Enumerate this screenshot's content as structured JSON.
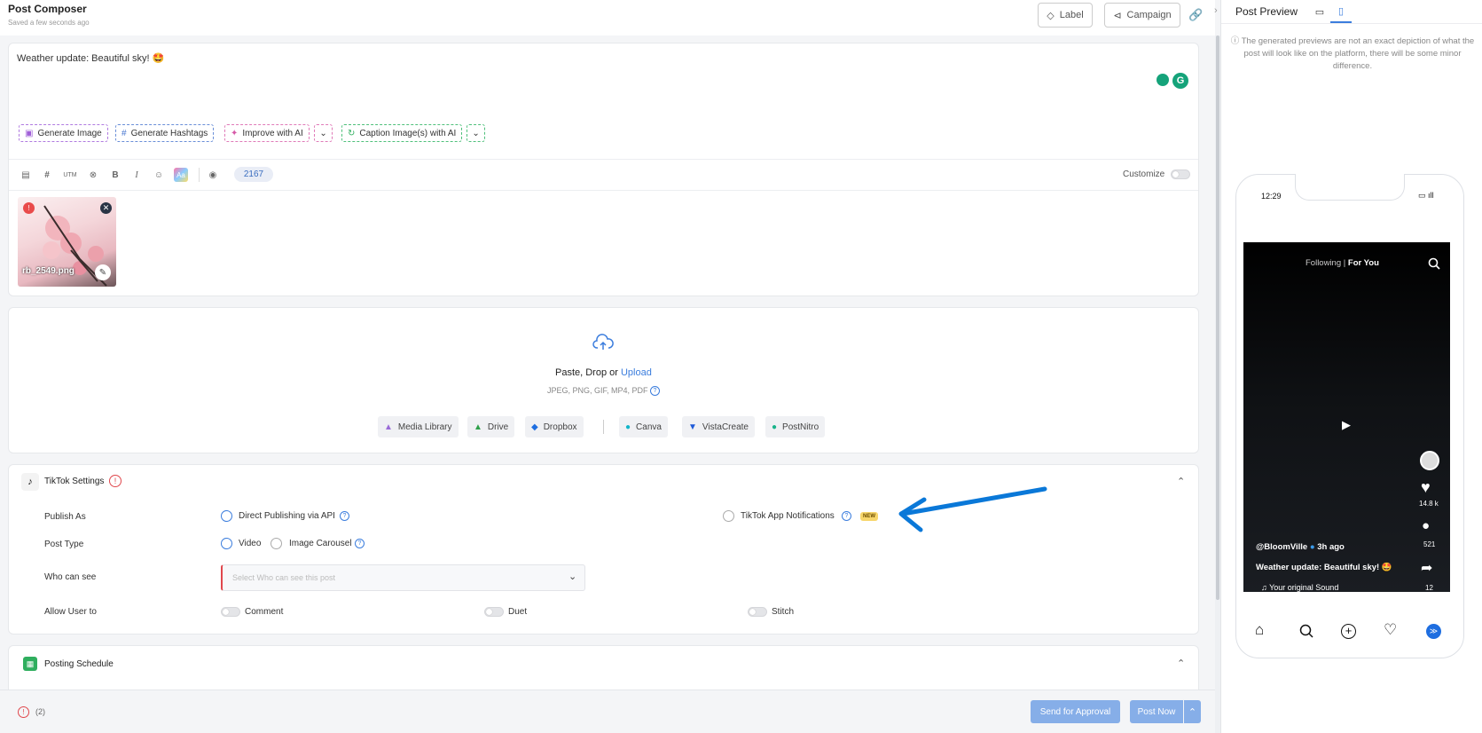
{
  "header": {
    "title": "Post Composer",
    "saved": "Saved a few seconds ago",
    "label_button": "Label",
    "campaign_button": "Campaign"
  },
  "editor": {
    "text": "Weather update: Beautiful sky! 🤩",
    "ai_buttons": {
      "generate_image": "Generate Image",
      "generate_hashtags": "Generate Hashtags",
      "improve": "Improve with AI",
      "caption": "Caption Image(s) with AI"
    },
    "toolbar": {
      "utm": "UTM",
      "bold": "B",
      "italic": "I",
      "char_count": "2167",
      "customize": "Customize"
    },
    "media": {
      "filename": "rb_2549.png"
    }
  },
  "upload": {
    "text_prefix": "Paste, Drop or ",
    "upload_link": "Upload",
    "formats": "JPEG, PNG, GIF, MP4, PDF",
    "sources": [
      "Media Library",
      "Drive",
      "Dropbox",
      "Canva",
      "VistaCreate",
      "PostNitro"
    ]
  },
  "tiktok": {
    "title": "TikTok Settings",
    "publish_as_label": "Publish As",
    "direct_publishing": "Direct Publishing via API",
    "app_notifications": "TikTok App Notifications",
    "new_badge": "NEW",
    "post_type_label": "Post Type",
    "video": "Video",
    "image_carousel": "Image Carousel",
    "who_can_see_label": "Who can see",
    "who_can_see_placeholder": "Select Who can see this post",
    "allow_label": "Allow User to",
    "comment": "Comment",
    "duet": "Duet",
    "stitch": "Stitch"
  },
  "schedule": {
    "title": "Posting Schedule"
  },
  "footer": {
    "error_count": "(2)",
    "send_approval": "Send for Approval",
    "post_now": "Post Now"
  },
  "preview": {
    "title": "Post Preview",
    "notice": "The generated previews are not an exact depiction of what the post will look like on the platform, there will be some minor difference.",
    "time": "12:29",
    "tabs_following": "Following | ",
    "tabs_foryou": "For You",
    "likes": "14.8 k",
    "comments": "521",
    "shares": "12",
    "username": "@BloomVille",
    "ago": "3h ago",
    "caption": "Weather update: Beautiful sky! 🤩",
    "sound": "Your original Sound"
  },
  "colors": {
    "accent": "#3b7ddd",
    "arrow": "#0a78d8",
    "primary_disabled": "#86aee8"
  }
}
